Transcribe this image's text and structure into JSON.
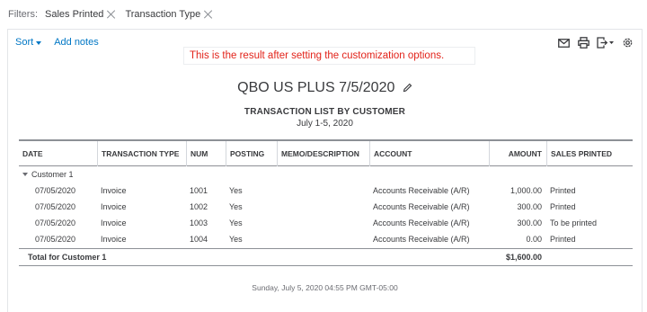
{
  "filters": {
    "label": "Filters:",
    "chips": [
      "Sales Printed",
      "Transaction Type"
    ]
  },
  "toolbar": {
    "sort_label": "Sort",
    "add_notes_label": "Add notes",
    "icons": [
      "email-icon",
      "print-icon",
      "export-icon",
      "settings-icon"
    ]
  },
  "annotation": "This is the result after setting the customization options.",
  "report": {
    "company_title": "QBO US PLUS 7/5/2020",
    "report_name": "TRANSACTION LIST BY CUSTOMER",
    "date_range": "July 1-5, 2020"
  },
  "table": {
    "columns": [
      "DATE",
      "TRANSACTION TYPE",
      "NUM",
      "POSTING",
      "MEMO/DESCRIPTION",
      "ACCOUNT",
      "AMOUNT",
      "SALES PRINTED"
    ],
    "group_label": "Customer 1",
    "rows": [
      {
        "date": "07/05/2020",
        "type": "Invoice",
        "num": "1001",
        "posting": "Yes",
        "memo": "",
        "account": "Accounts Receivable (A/R)",
        "amount": "1,000.00",
        "sales_printed": "Printed"
      },
      {
        "date": "07/05/2020",
        "type": "Invoice",
        "num": "1002",
        "posting": "Yes",
        "memo": "",
        "account": "Accounts Receivable (A/R)",
        "amount": "300.00",
        "sales_printed": "Printed"
      },
      {
        "date": "07/05/2020",
        "type": "Invoice",
        "num": "1003",
        "posting": "Yes",
        "memo": "",
        "account": "Accounts Receivable (A/R)",
        "amount": "300.00",
        "sales_printed": "To be printed"
      },
      {
        "date": "07/05/2020",
        "type": "Invoice",
        "num": "1004",
        "posting": "Yes",
        "memo": "",
        "account": "Accounts Receivable (A/R)",
        "amount": "0.00",
        "sales_printed": "Printed"
      }
    ],
    "total_label": "Total for Customer 1",
    "total_amount": "$1,600.00"
  },
  "footer": "Sunday, July 5, 2020  04:55 PM GMT-05:00"
}
